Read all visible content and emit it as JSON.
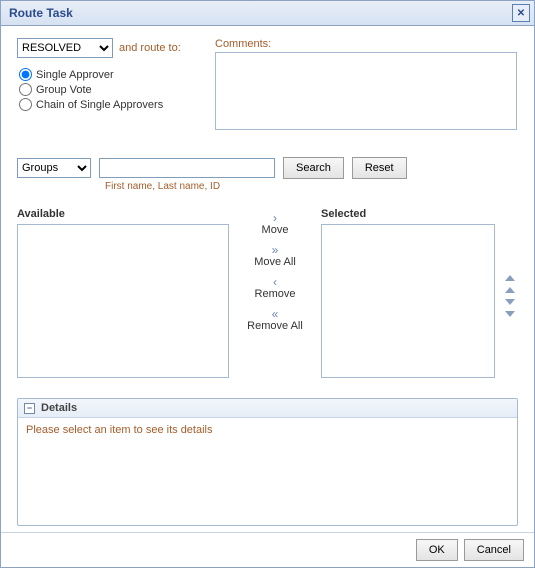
{
  "window": {
    "title": "Route Task"
  },
  "status": {
    "select_value": "RESOLVED",
    "and_route_to": "and route to:"
  },
  "radios": {
    "single": "Single Approver",
    "group": "Group Vote",
    "chain": "Chain of Single Approvers",
    "checked": "single"
  },
  "comments": {
    "label": "Comments:",
    "value": ""
  },
  "search": {
    "scope_value": "Groups",
    "query": "",
    "search_label": "Search",
    "reset_label": "Reset",
    "hint": "First name, Last name, ID"
  },
  "dual": {
    "available_label": "Available",
    "selected_label": "Selected",
    "move": "Move",
    "move_all": "Move All",
    "remove": "Remove",
    "remove_all": "Remove All"
  },
  "details": {
    "title": "Details",
    "empty_text": "Please select an item to see its details"
  },
  "footer": {
    "ok": "OK",
    "cancel": "Cancel"
  }
}
